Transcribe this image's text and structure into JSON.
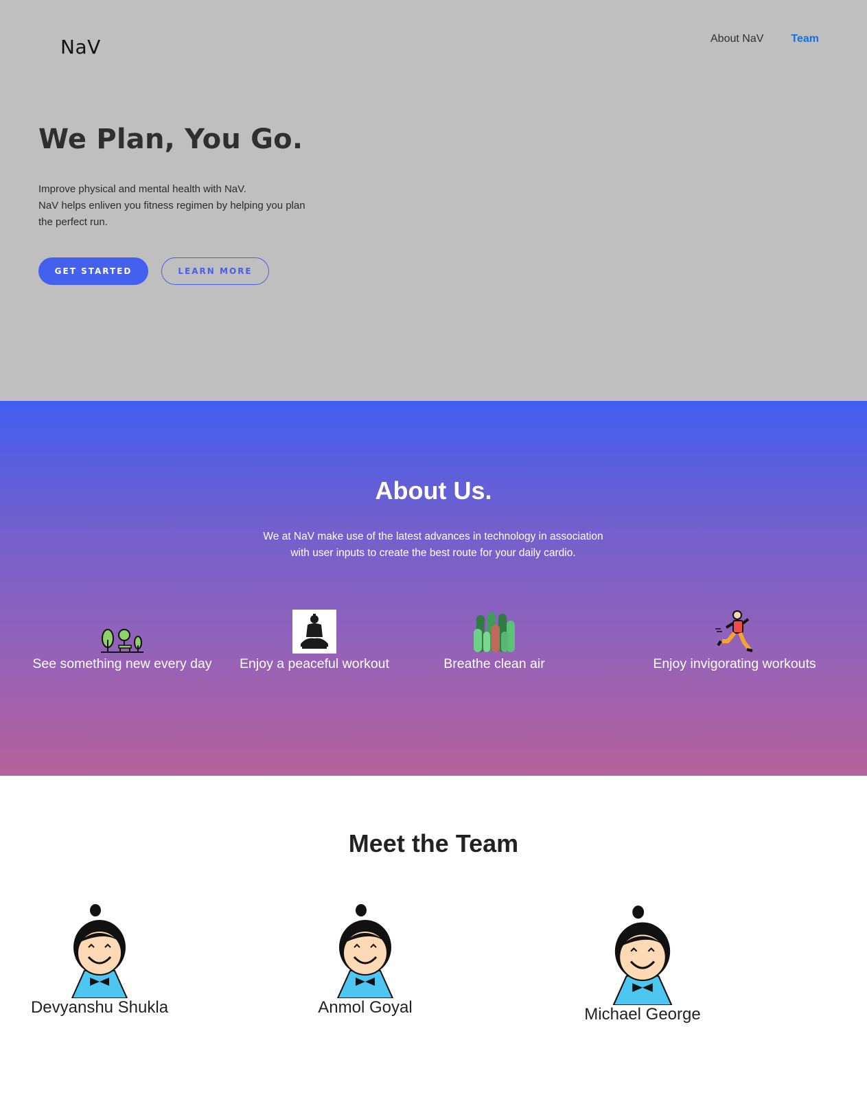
{
  "header": {
    "brand": "NaV",
    "nav": [
      {
        "label": "About NaV"
      },
      {
        "label": "Team"
      }
    ]
  },
  "hero": {
    "title": "We Plan, You Go.",
    "lines": [
      "Improve physical and mental health with NaV.",
      "NaV helps enliven you fitness regimen by helping you plan",
      "the perfect run."
    ],
    "primary_button": "GET STARTED",
    "secondary_button": "LEARN MORE"
  },
  "about": {
    "title": "About Us.",
    "text_line1": "We at NaV make use of the latest advances in technology in association",
    "text_line2": "with user inputs to create the best route for your daily cardio.",
    "features": [
      {
        "label": "See something new every day",
        "icon": "park-icon"
      },
      {
        "label": "Enjoy a peaceful workout",
        "icon": "meditation-icon"
      },
      {
        "label": "Breathe clean air",
        "icon": "forest-icon"
      },
      {
        "label": "Enjoy invigorating workouts",
        "icon": "runner-icon"
      }
    ]
  },
  "team": {
    "title": "Meet the Team",
    "members": [
      {
        "name": "Devyanshu Shukla"
      },
      {
        "name": "Anmol Goyal"
      },
      {
        "name": "Michael George"
      }
    ]
  },
  "colors": {
    "hero_bg": "#bfbfbf",
    "accent": "#4460ef",
    "nav_active": "#1a6fe0",
    "gradient_top": "#415ef2",
    "gradient_bottom": "#b5619b"
  }
}
